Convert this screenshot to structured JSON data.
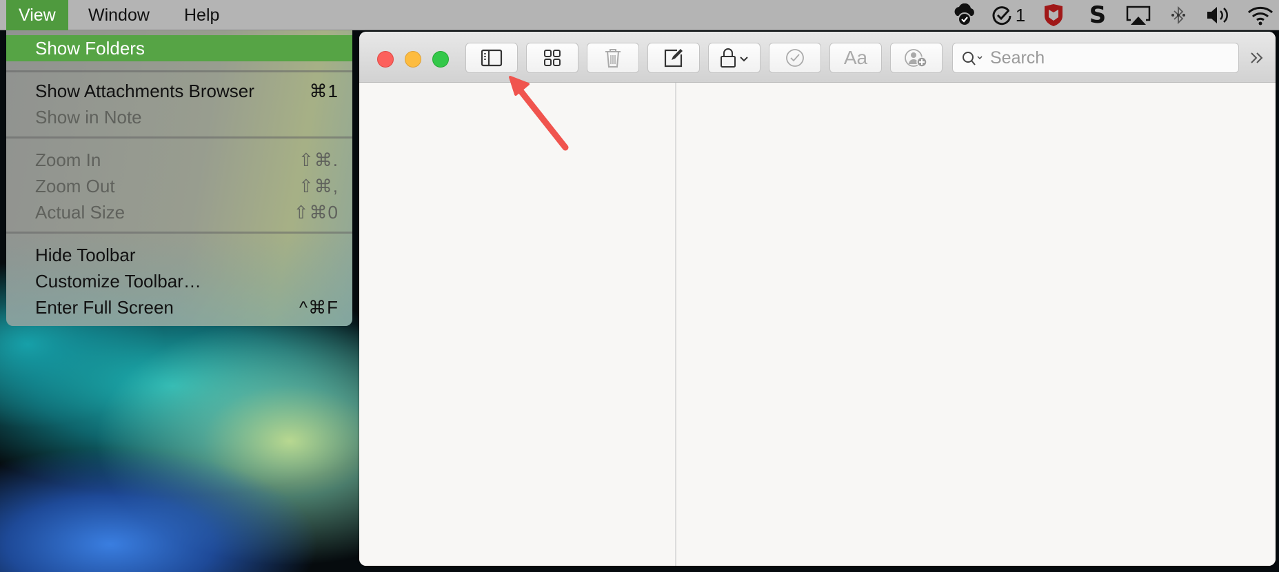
{
  "menubar": {
    "items": [
      {
        "label": "View",
        "active": true
      },
      {
        "label": "Window",
        "active": false
      },
      {
        "label": "Help",
        "active": false
      }
    ],
    "tray": {
      "icons": [
        "cloud-check-icon",
        "task-check-icon",
        "mcafee-shield-icon",
        "s-app-icon",
        "airplay-icon",
        "bluetooth-icon",
        "volume-icon",
        "wifi-icon"
      ],
      "task_count": "1"
    }
  },
  "view_menu": {
    "items": [
      {
        "label": "Show Folders",
        "shortcut": "",
        "enabled": true,
        "highlighted": true
      },
      {
        "label": "Show Attachments Browser",
        "shortcut": "⌘1",
        "enabled": true,
        "highlighted": false
      },
      {
        "label": "Show in Note",
        "shortcut": "",
        "enabled": false,
        "highlighted": false
      },
      {
        "label": "Zoom In",
        "shortcut": "⇧⌘.",
        "enabled": false,
        "highlighted": false
      },
      {
        "label": "Zoom Out",
        "shortcut": "⇧⌘,",
        "enabled": false,
        "highlighted": false
      },
      {
        "label": "Actual Size",
        "shortcut": "⇧⌘0",
        "enabled": false,
        "highlighted": false
      },
      {
        "label": "Hide Toolbar",
        "shortcut": "",
        "enabled": true,
        "highlighted": false
      },
      {
        "label": "Customize Toolbar…",
        "shortcut": "",
        "enabled": true,
        "highlighted": false
      },
      {
        "label": "Enter Full Screen",
        "shortcut": "^⌘F",
        "enabled": true,
        "highlighted": false
      }
    ]
  },
  "window": {
    "toolbar": {
      "buttons": [
        {
          "name": "toggle-sidebar-button",
          "icon": "sidebar-icon"
        },
        {
          "name": "attachments-grid-button",
          "icon": "grid-icon"
        },
        {
          "name": "delete-button",
          "icon": "trash-icon"
        },
        {
          "name": "new-note-button",
          "icon": "compose-icon"
        },
        {
          "name": "lock-button",
          "icon": "lock-icon"
        },
        {
          "name": "checklist-button",
          "icon": "checkmark-circle-icon"
        },
        {
          "name": "format-button",
          "icon": "text-format-icon",
          "label": "Aa"
        },
        {
          "name": "add-people-button",
          "icon": "add-person-icon"
        }
      ],
      "search_placeholder": "Search",
      "overflow_label": "»"
    }
  },
  "colors": {
    "menu_highlight": "#56a445",
    "close": "#fc605c",
    "minimize": "#fdbc40",
    "zoom": "#34c84a",
    "annotation_arrow": "#f0544e"
  }
}
